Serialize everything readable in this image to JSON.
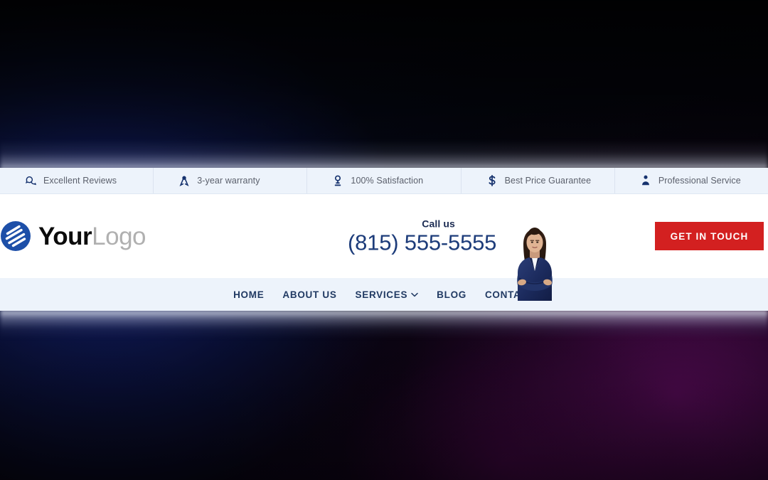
{
  "colors": {
    "topbar_bg": "#edf3fb",
    "topbar_text": "#5a5f6b",
    "icon_navy": "#16326e",
    "logo_dark": "#0b0b0b",
    "logo_gray": "#b0b0b0",
    "phone_navy": "#1d3c7a",
    "cta_red": "#d32020",
    "nav_text": "#213a63",
    "navbar_bg": "#edf3fb",
    "backdrop_blue": "#12206e",
    "backdrop_purple": "#600c60"
  },
  "topbar": {
    "items": [
      {
        "icon": "chat-bubble-icon",
        "label": "Excellent Reviews"
      },
      {
        "icon": "award-ribbon-icon",
        "label": "3-year warranty"
      },
      {
        "icon": "award-medal-icon",
        "label": "100% Satisfaction"
      },
      {
        "icon": "dollar-sign-icon",
        "label": "Best Price Guarantee"
      },
      {
        "icon": "user-tie-icon",
        "label": "Professional Service"
      }
    ]
  },
  "header": {
    "logo": {
      "icon": "swirl-circle-logo-icon",
      "text_primary": "Your",
      "text_secondary": "Logo"
    },
    "phone": {
      "label": "Call us",
      "number": "(815) 555-5555"
    },
    "agent_photo_alt": "businesswoman-photo",
    "cta": {
      "label": "GET IN TOUCH"
    }
  },
  "nav": {
    "items": [
      {
        "label": "HOME",
        "has_dropdown": false
      },
      {
        "label": "ABOUT US",
        "has_dropdown": false
      },
      {
        "label": "SERVICES",
        "has_dropdown": true
      },
      {
        "label": "BLOG",
        "has_dropdown": false
      },
      {
        "label": "CONTACT",
        "has_dropdown": false
      }
    ]
  }
}
